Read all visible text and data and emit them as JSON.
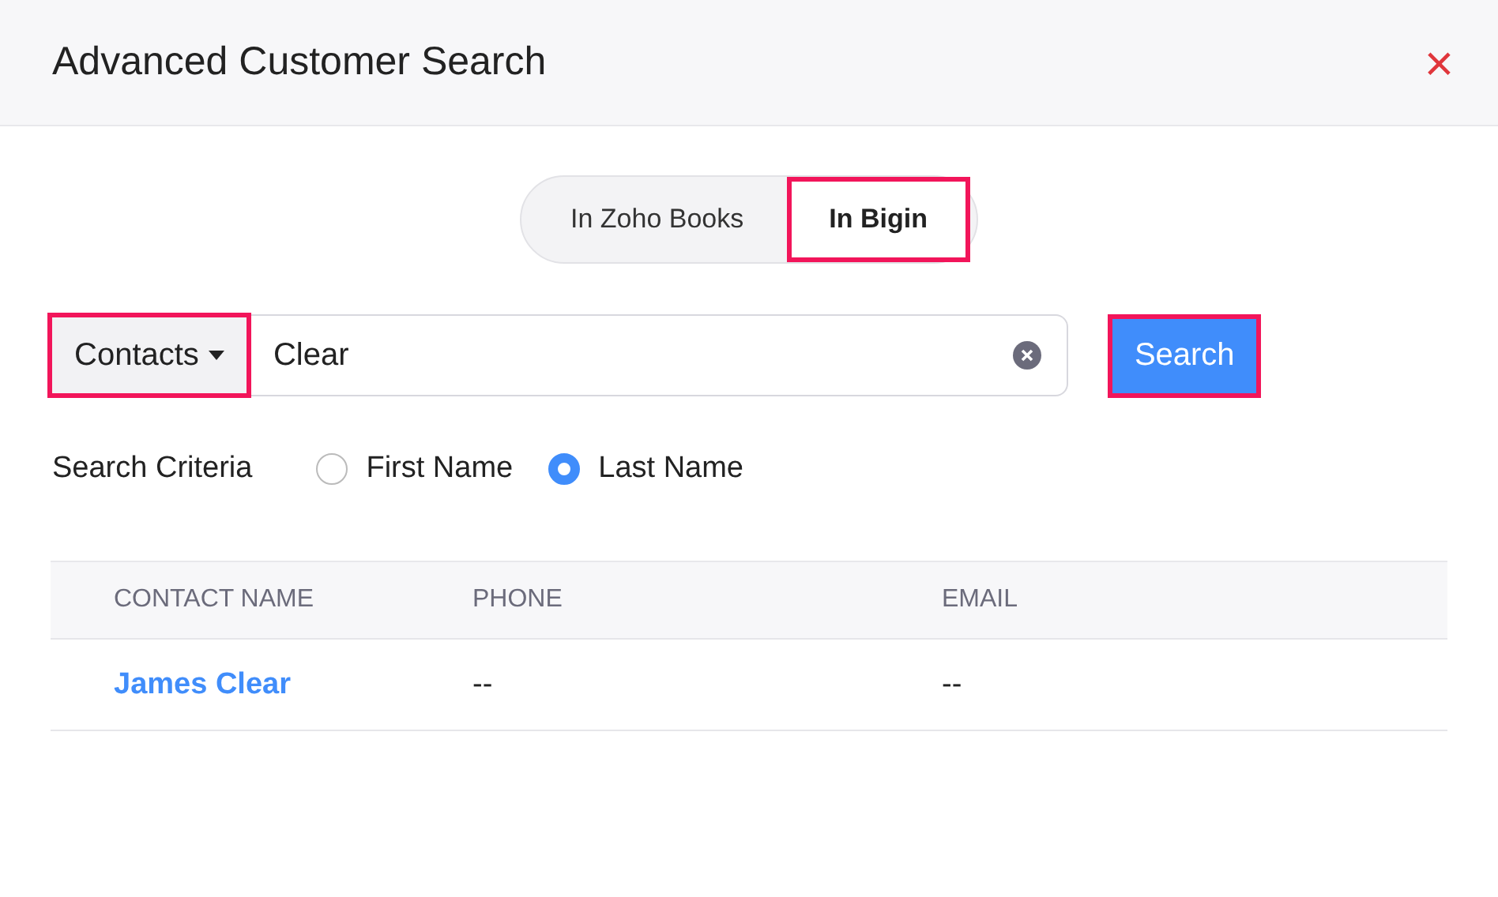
{
  "dialog": {
    "title": "Advanced Customer Search",
    "close": "×"
  },
  "tabs": [
    {
      "label": "In Zoho Books",
      "selected": false,
      "highlighted": false
    },
    {
      "label": "In Bigin",
      "selected": true,
      "highlighted": true
    }
  ],
  "search": {
    "module": "Contacts",
    "module_highlighted": true,
    "value": "Clear",
    "button": "Search",
    "button_highlighted": true
  },
  "criteria": {
    "label": "Search Criteria",
    "options": [
      {
        "label": "First Name",
        "selected": false
      },
      {
        "label": "Last Name",
        "selected": true
      }
    ]
  },
  "table": {
    "columns": [
      "CONTACT NAME",
      "PHONE",
      "EMAIL"
    ],
    "rows": [
      {
        "cells": [
          "James Clear",
          "--",
          "--"
        ]
      }
    ]
  }
}
